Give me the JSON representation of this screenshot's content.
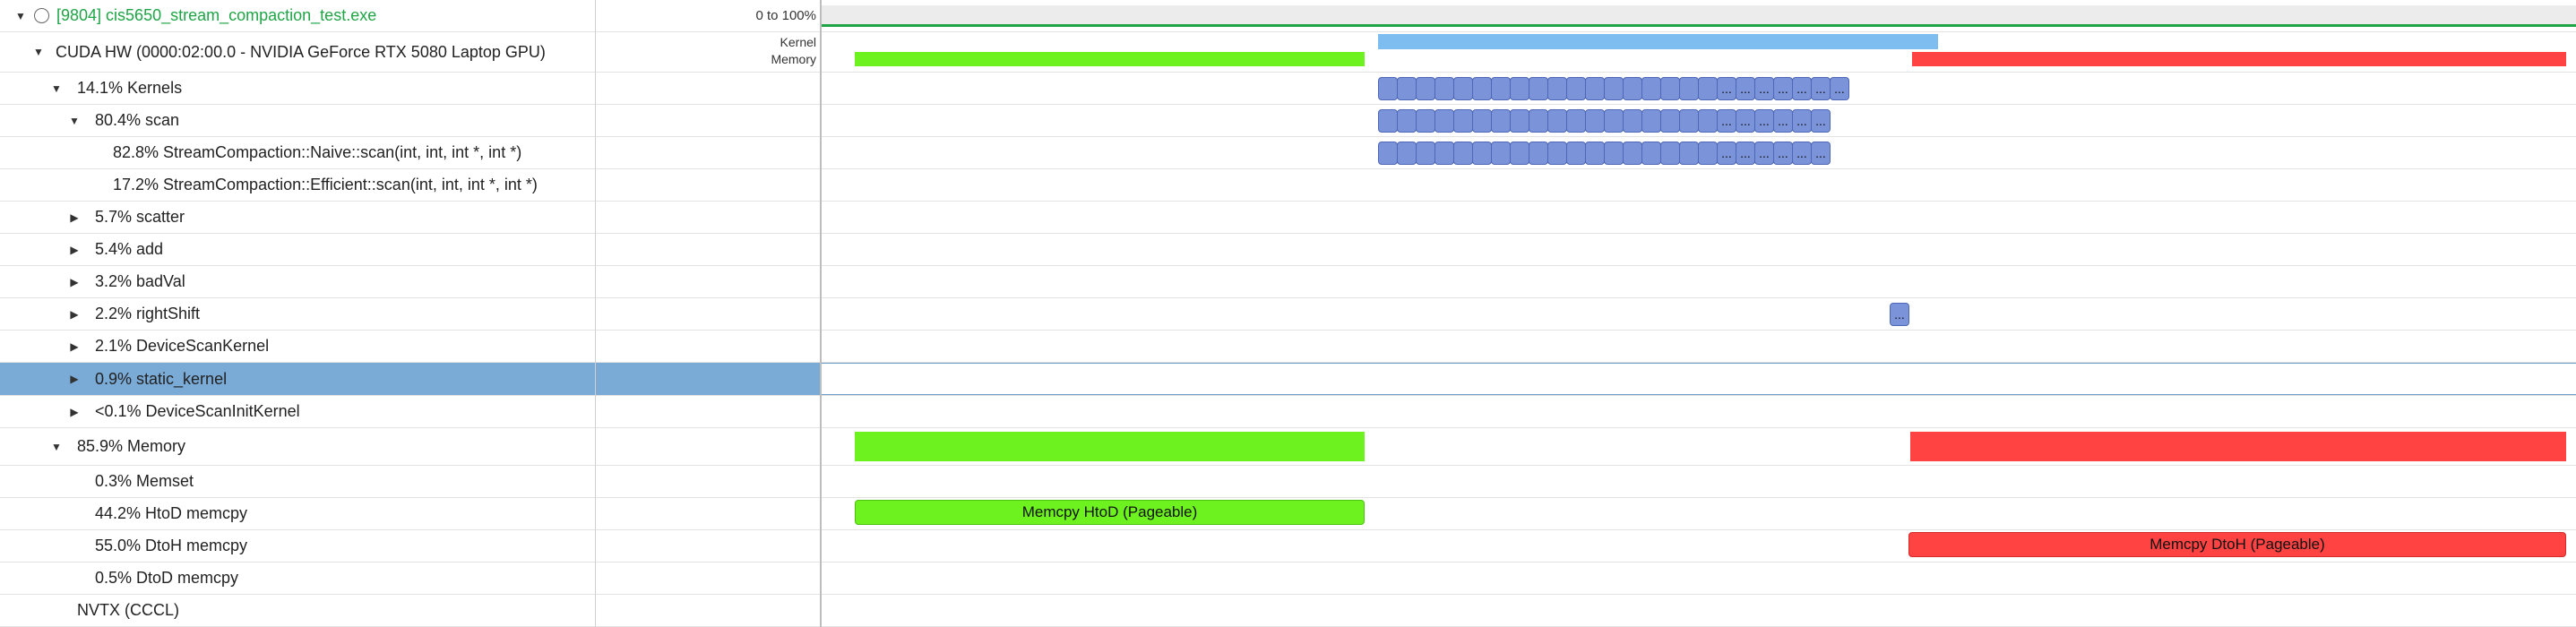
{
  "process": {
    "label": "[9804] cis5650_stream_compaction_test.exe",
    "scale": "0 to 100%"
  },
  "gpu_row": {
    "label": "CUDA HW (0000:02:00.0 - NVIDIA GeForce RTX 5080 Laptop GPU)",
    "kernel_label": "Kernel",
    "memory_label": "Memory"
  },
  "rows": [
    {
      "label": "14.1% Kernels"
    },
    {
      "label": "80.4% scan"
    },
    {
      "label": "82.8% StreamCompaction::Naive::scan(int, int, int *, int *)"
    },
    {
      "label": "17.2% StreamCompaction::Efficient::scan(int, int, int *, int *)"
    },
    {
      "label": "5.7% scatter"
    },
    {
      "label": "5.4% add"
    },
    {
      "label": "3.2% badVal"
    },
    {
      "label": "2.2% rightShift"
    },
    {
      "label": "2.1% DeviceScanKernel"
    },
    {
      "label": "0.9% static_kernel"
    },
    {
      "label": "<0.1% DeviceScanInitKernel"
    },
    {
      "label": "85.9% Memory"
    },
    {
      "label": "0.3% Memset"
    },
    {
      "label": "44.2% HtoD memcpy"
    },
    {
      "label": "55.0% DtoH memcpy"
    },
    {
      "label": "0.5% DtoD memcpy"
    },
    {
      "label": "NVTX (CCCL)"
    }
  ],
  "timeline": {
    "htod_bar_label": "Memcpy HtoD (Pageable)",
    "dtoh_bar_label": "Memcpy DtoH (Pageable)",
    "ellipsis": "...",
    "colors": {
      "htod": "#6ef21f",
      "dtoh": "#ff4242",
      "kernel": "#7b93d9",
      "kernel_util": "#7dbdf0",
      "process_green": "#1fa546",
      "selected": "#7aaad6"
    }
  }
}
